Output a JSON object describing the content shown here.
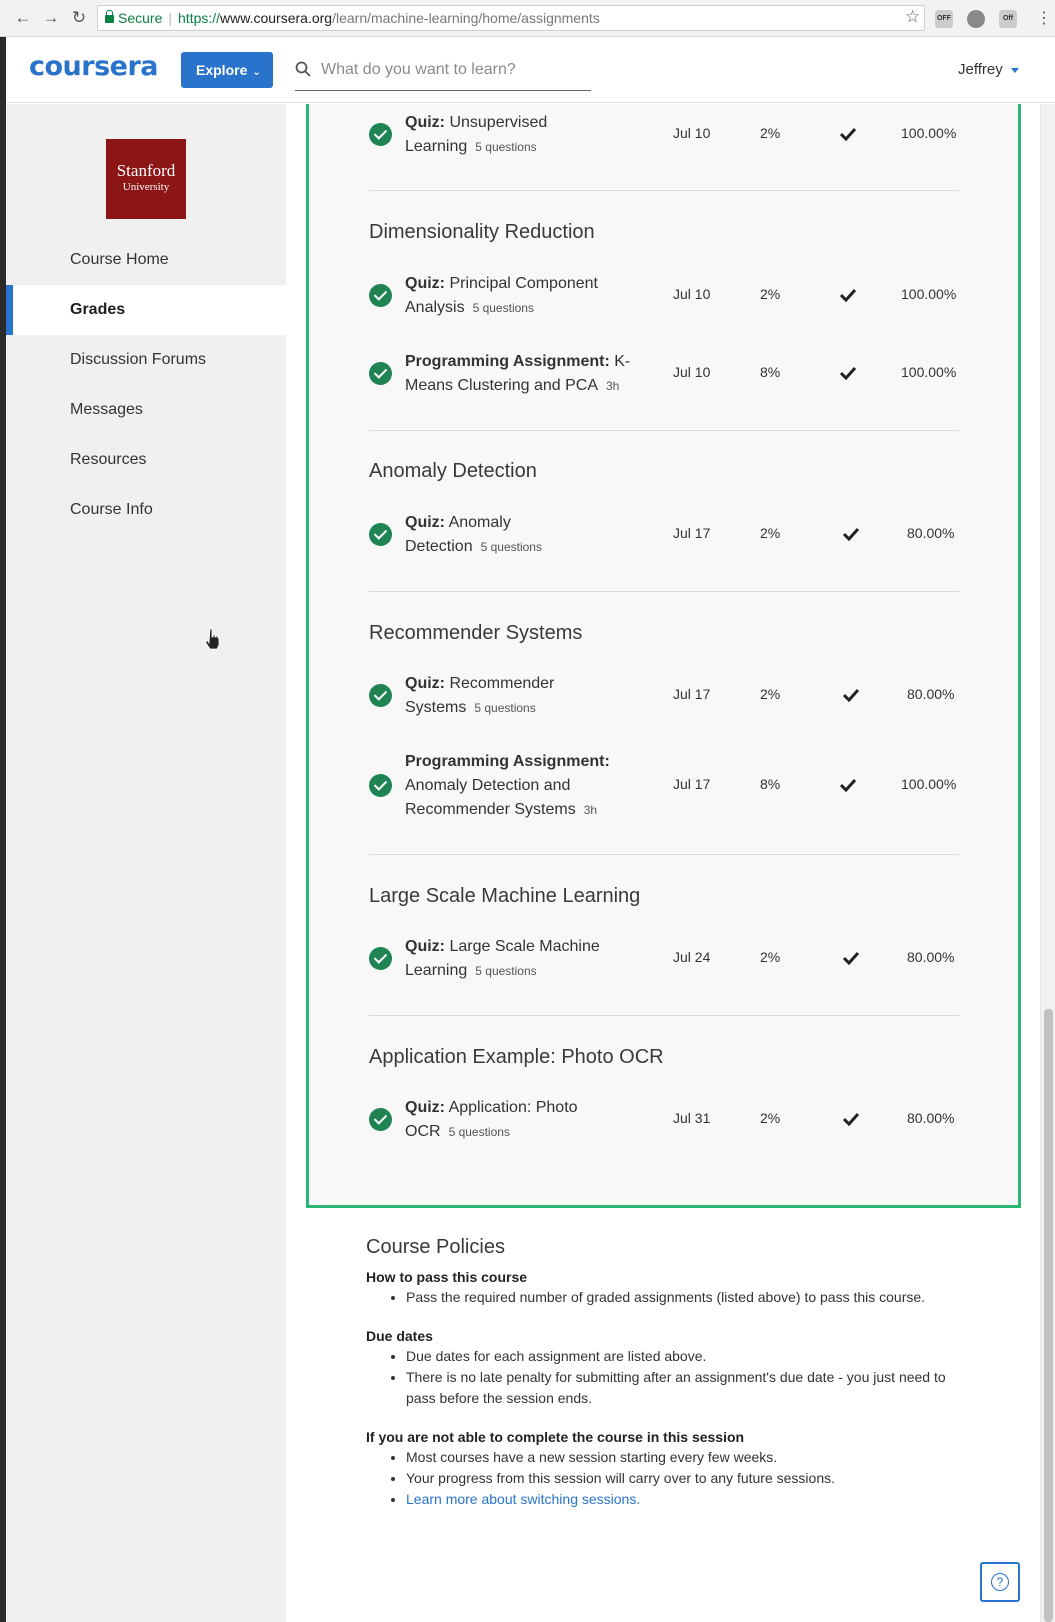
{
  "browser": {
    "secure_label": "Secure",
    "url_scheme": "https://",
    "url_host": "www.coursera.org",
    "url_path": "/learn/machine-learning/home/assignments",
    "ext1": "OFF",
    "ext3": "Off"
  },
  "header": {
    "logo": "coursera",
    "explore_label": "Explore",
    "search_placeholder": "What do you want to learn?",
    "user_name": "Jeffrey"
  },
  "sidebar": {
    "logo_line1": "Stanford",
    "logo_line2": "University",
    "items": [
      {
        "label": "Course Home"
      },
      {
        "label": "Grades"
      },
      {
        "label": "Discussion Forums"
      },
      {
        "label": "Messages"
      },
      {
        "label": "Resources"
      },
      {
        "label": "Course Info"
      }
    ]
  },
  "grades": {
    "top_item": {
      "type": "Quiz:",
      "name_a": "Unsupervised",
      "name_b": "Learning",
      "meta": "5 questions",
      "due": "Jul 10",
      "weight": "2%",
      "grade": "100.00%"
    },
    "sections": [
      {
        "title": "Dimensionality Reduction",
        "items": [
          {
            "type": "Quiz:",
            "name_a": "Principal Component",
            "name_b": "Analysis",
            "meta": "5 questions",
            "due": "Jul 10",
            "weight": "2%",
            "grade": "100.00%"
          },
          {
            "type": "Programming Assignment:",
            "name_a": "K-",
            "name_b": "Means Clustering and PCA",
            "meta": "3h",
            "due": "Jul 10",
            "weight": "8%",
            "grade": "100.00%"
          }
        ]
      },
      {
        "title": "Anomaly Detection",
        "items": [
          {
            "type": "Quiz:",
            "name_a": "Anomaly",
            "name_b": "Detection",
            "meta": "5 questions",
            "due": "Jul 17",
            "weight": "2%",
            "grade": "80.00%"
          }
        ]
      },
      {
        "title": "Recommender Systems",
        "items": [
          {
            "type": "Quiz:",
            "name_a": "Recommender",
            "name_b": "Systems",
            "meta": "5 questions",
            "due": "Jul 17",
            "weight": "2%",
            "grade": "80.00%"
          },
          {
            "type": "Programming Assignment:",
            "name_a": "",
            "name_b": "Anomaly Detection and",
            "name_c": "Recommender Systems",
            "meta": "3h",
            "due": "Jul 17",
            "weight": "8%",
            "grade": "100.00%"
          }
        ]
      },
      {
        "title": "Large Scale Machine Learning",
        "items": [
          {
            "type": "Quiz:",
            "name_a": "Large Scale Machine",
            "name_b": "Learning",
            "meta": "5 questions",
            "due": "Jul 24",
            "weight": "2%",
            "grade": "80.00%"
          }
        ]
      },
      {
        "title": "Application Example: Photo OCR",
        "items": [
          {
            "type": "Quiz:",
            "name_a": "Application: Photo",
            "name_b": "OCR",
            "meta": "5 questions",
            "due": "Jul 31",
            "weight": "2%",
            "grade": "80.00%"
          }
        ]
      }
    ]
  },
  "policies": {
    "title": "Course Policies",
    "pass_heading": "How to pass this course",
    "pass_1": "Pass the required number of graded assignments (listed above) to pass this course.",
    "due_heading": "Due dates",
    "due_1": "Due dates for each assignment are listed above.",
    "due_2": "There is no late penalty for submitting after an assignment's due date - you just need to pass before the session ends.",
    "session_heading": "If you are not able to complete the course in this session",
    "session_1": "Most courses have a new session starting every few weeks.",
    "session_2": "Your progress from this session will carry over to any future sessions.",
    "session_link": "Learn more about switching sessions."
  },
  "help_label": "?",
  "colors": {
    "accent": "#2a73cc",
    "success": "#1f8354",
    "panel_border": "#2bb673",
    "stanford": "#8c1515"
  }
}
